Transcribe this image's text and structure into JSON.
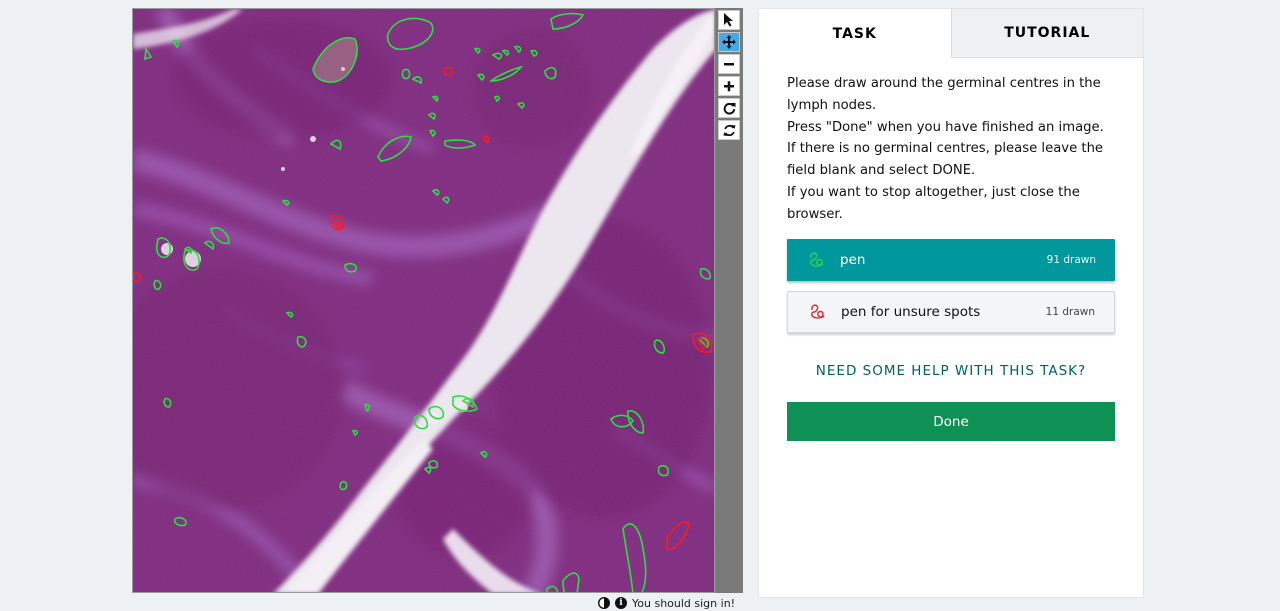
{
  "viewer": {
    "tools": [
      {
        "name": "select-tool",
        "icon": "arrow-pointer-icon",
        "active": false
      },
      {
        "name": "move-tool",
        "icon": "move-arrows-icon",
        "active": true
      },
      {
        "name": "zoom-out-tool",
        "icon": "minus-icon",
        "active": false
      },
      {
        "name": "zoom-in-tool",
        "icon": "plus-icon",
        "active": false
      },
      {
        "name": "rotate-tool",
        "icon": "rotate-icon",
        "active": false
      },
      {
        "name": "reset-tool",
        "icon": "reset-icon",
        "active": false
      }
    ],
    "footer_text": "You should sign in!",
    "footer_icons": [
      "contrast-icon",
      "info-icon"
    ]
  },
  "panel": {
    "tabs": [
      "TASK",
      "TUTORIAL"
    ],
    "active_tab": "TASK",
    "instructions": [
      "Please draw around the germinal centres in the lymph nodes.",
      "Press \"Done\" when you have finished an image.",
      "If there is no germinal centres, please leave the field blank and select DONE.",
      "If you want to stop altogether, just close the browser."
    ],
    "tools": [
      {
        "label": "pen",
        "count": "91 drawn",
        "color": "#22c238",
        "active": true
      },
      {
        "label": "pen for unsure spots",
        "count": "11 drawn",
        "color": "#e3262f",
        "active": false
      }
    ],
    "help_link": "NEED SOME HELP WITH THIS TASK?",
    "done_label": "Done"
  },
  "colors": {
    "accent_teal": "#00979d",
    "done_green": "#0f9055",
    "active_tool_blue": "#43a9e8",
    "tissue_purple": "#7d2f7e"
  }
}
